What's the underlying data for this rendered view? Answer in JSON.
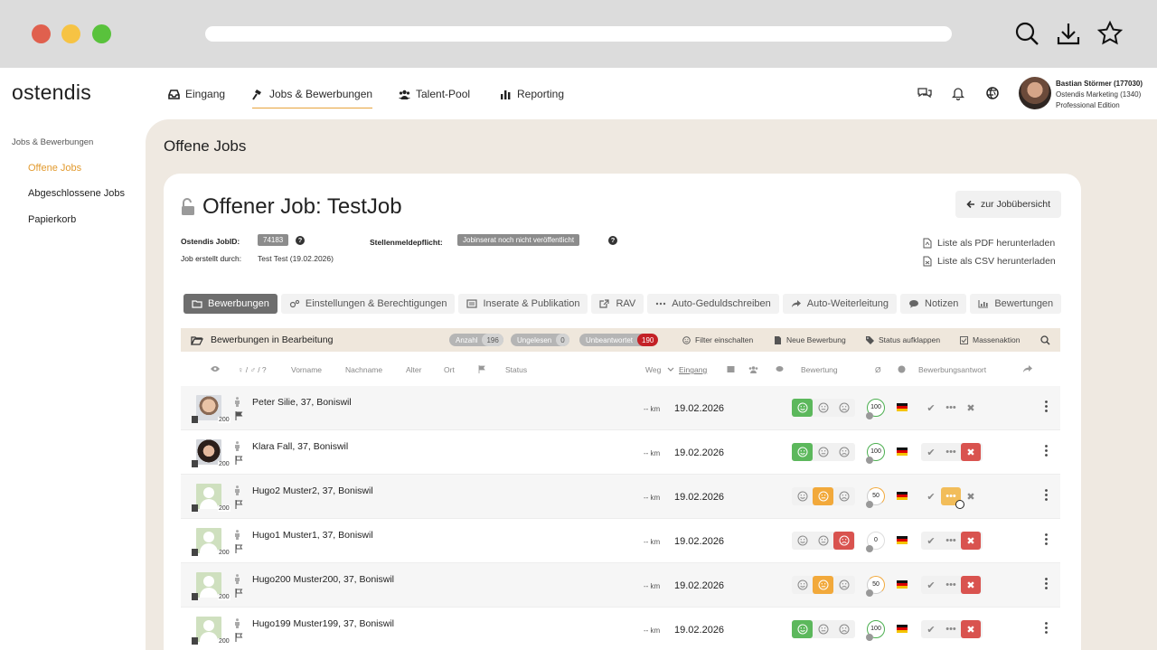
{
  "brand": {
    "logo": "ostendis",
    "accent": "#e8a33c"
  },
  "nav": {
    "items": [
      {
        "label": "Eingang",
        "icon": "inbox-icon"
      },
      {
        "label": "Jobs & Bewerbungen",
        "icon": "hammer-icon"
      },
      {
        "label": "Talent-Pool",
        "icon": "users-icon"
      },
      {
        "label": "Reporting",
        "icon": "bar-chart-icon"
      }
    ]
  },
  "user": {
    "name": "Bastian Störmer (177030)",
    "company": "Ostendis Marketing (1340)",
    "edition": "Professional Edition"
  },
  "sidebar": {
    "title": "Jobs & Bewerbungen",
    "items": [
      {
        "label": "Offene Jobs"
      },
      {
        "label": "Abgeschlossene Jobs"
      },
      {
        "label": "Papierkorb"
      }
    ]
  },
  "page": {
    "title": "Offene Jobs"
  },
  "job": {
    "title": "Offener Job: TestJob",
    "back": "zur Jobübersicht",
    "id_label": "Ostendis JobID:",
    "id_value": "74183",
    "created_label": "Job erstellt durch:",
    "created_value": "Test Test (19.02.2026)",
    "meldepflicht_label": "Stellenmeldepflicht:",
    "meldepflicht_value": "Jobinserat noch nicht veröffentlicht",
    "pdf": "Liste als PDF herunterladen",
    "csv": "Liste als CSV herunterladen"
  },
  "tabs": [
    {
      "label": "Bewerbungen"
    },
    {
      "label": "Einstellungen & Berechtigungen"
    },
    {
      "label": "Inserate & Publikation"
    },
    {
      "label": "RAV"
    },
    {
      "label": "Auto-Geduldschreiben"
    },
    {
      "label": "Auto-Weiterleitung"
    },
    {
      "label": "Notizen"
    },
    {
      "label": "Bewertungen"
    }
  ],
  "table": {
    "title": "Bewerbungen in Bearbeitung",
    "badges": {
      "anzahl_label": "Anzahl",
      "anzahl": "196",
      "ungelesen_label": "Ungelesen",
      "ungelesen": "0",
      "unbeantwortet_label": "Unbeantwortet",
      "unbeantwortet": "190"
    },
    "actions": {
      "filter": "Filter einschalten",
      "neue": "Neue Bewerbung",
      "status": "Status aufklappen",
      "masse": "Massenaktion"
    },
    "columns": {
      "gender": "♀ / ♂ / ?",
      "vorname": "Vorname",
      "nachname": "Nachname",
      "alter": "Alter",
      "ort": "Ort",
      "status": "Status",
      "weg": "Weg",
      "eingang": "Eingang",
      "bewertung": "Bewertung",
      "avg": "Ø",
      "antwort": "Bewerbungsantwort"
    },
    "rows": [
      {
        "name": "Peter Silie, 37, Boniswil",
        "km": "-- km",
        "date": "19.02.2026",
        "score": "200",
        "match": "100",
        "photo": "m",
        "flag": "filled",
        "rating": "positive",
        "answer": "plain"
      },
      {
        "name": "Klara Fall, 37, Boniswil",
        "km": "-- km",
        "date": "19.02.2026",
        "score": "200",
        "match": "100",
        "photo": "f",
        "flag": "outline",
        "rating": "positive",
        "answer": "rejected"
      },
      {
        "name": "Hugo2 Muster2, 37, Boniswil",
        "km": "-- km",
        "date": "19.02.2026",
        "score": "200",
        "match": "50",
        "photo": "placeholder",
        "flag": "outline",
        "rating": "neutral",
        "answer": "pending"
      },
      {
        "name": "Hugo1 Muster1, 37, Boniswil",
        "km": "-- km",
        "date": "19.02.2026",
        "score": "200",
        "match": "0",
        "photo": "placeholder",
        "flag": "outline",
        "rating": "negative",
        "answer": "rejected"
      },
      {
        "name": "Hugo200 Muster200, 37, Boniswil",
        "km": "-- km",
        "date": "19.02.2026",
        "score": "200",
        "match": "50",
        "photo": "placeholder",
        "flag": "outline",
        "rating": "neutral",
        "answer": "rejected"
      },
      {
        "name": "Hugo199 Muster199, 37, Boniswil",
        "km": "-- km",
        "date": "19.02.2026",
        "score": "200",
        "match": "100",
        "photo": "placeholder",
        "flag": "outline",
        "rating": "positive",
        "answer": "rejected"
      }
    ]
  }
}
